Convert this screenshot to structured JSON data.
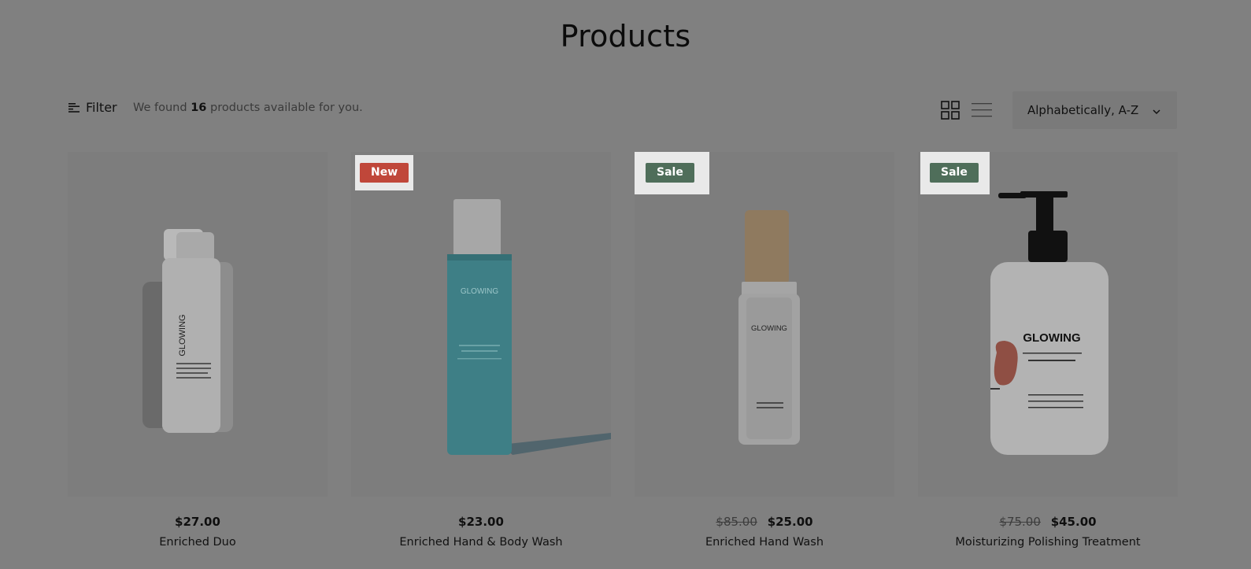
{
  "page": {
    "title": "Products"
  },
  "toolbar": {
    "filter_label": "Filter",
    "found_prefix": "We found",
    "found_count": "16",
    "found_suffix": "products available for you.",
    "sort_selected": "Alphabetically, A-Z"
  },
  "colors": {
    "badge_new": "#c0473a",
    "badge_sale": "#4f6e5a",
    "overlay": "#808080"
  },
  "icons": {
    "filter": "filter-lines-icon",
    "grid_view": "grid-view-icon",
    "list_view": "list-view-icon",
    "sort": "chevron-down-icon"
  },
  "products": [
    {
      "name": "Enriched Duo",
      "price": "$27.00",
      "old_price": "",
      "badge": "",
      "bottle_text": "GLOWING"
    },
    {
      "name": "Enriched Hand & Body Wash",
      "price": "$23.00",
      "old_price": "",
      "badge": "New",
      "bottle_text": "GLOWING"
    },
    {
      "name": "Enriched Hand Wash",
      "price": "$25.00",
      "old_price": "$85.00",
      "badge": "Sale",
      "bottle_text": "GLOWING"
    },
    {
      "name": "Moisturizing Polishing Treatment",
      "price": "$45.00",
      "old_price": "$75.00",
      "badge": "Sale",
      "bottle_text": "GLOWING"
    }
  ]
}
